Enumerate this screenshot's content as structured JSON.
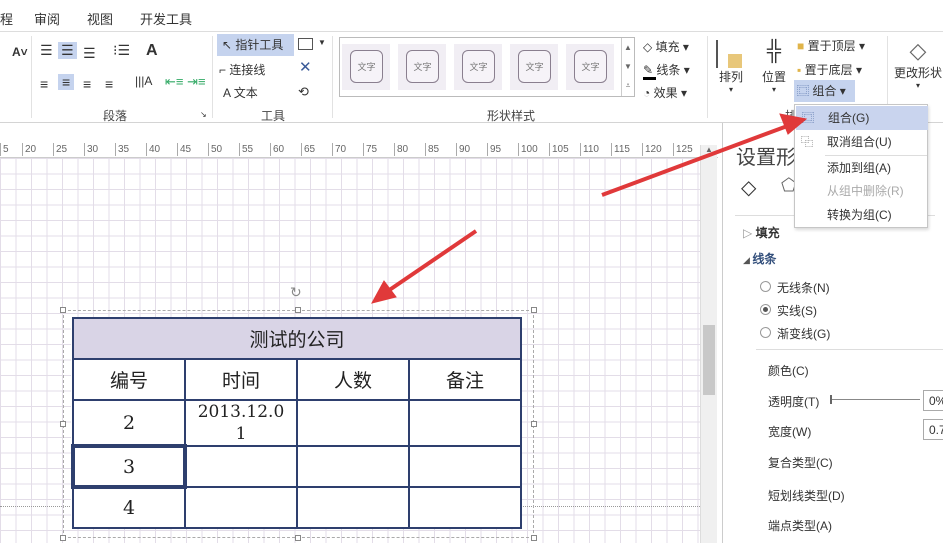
{
  "menu": {
    "tabs": [
      "程",
      "审阅",
      "视图",
      "开发工具"
    ]
  },
  "ribbon": {
    "paragraph_group": "段落",
    "tools_group": {
      "label": "工具",
      "pointer": "指针工具",
      "connector": "连接线",
      "text": "文本"
    },
    "shape_styles_group": {
      "label": "形状样式",
      "tile_text": "文字",
      "fill": "填充",
      "line": "线条",
      "effect": "效果"
    },
    "arrange_group": {
      "label": "排",
      "arrange": "排列",
      "position": "位置",
      "bring_front": "置于顶层",
      "send_back": "置于底层",
      "group": "组合"
    },
    "change_shape": "更改形状"
  },
  "ruler": [
    "5",
    "20",
    "25",
    "30",
    "35",
    "40",
    "45",
    "50",
    "55",
    "60",
    "65",
    "70",
    "75",
    "80",
    "85",
    "90",
    "95",
    "100",
    "105",
    "110",
    "115",
    "120",
    "125"
  ],
  "group_menu": {
    "items": [
      {
        "label": "组合(G)",
        "enabled": true,
        "highlighted": true
      },
      {
        "label": "取消组合(U)",
        "enabled": true
      },
      {
        "label": "添加到组(A)",
        "enabled": true
      },
      {
        "label": "从组中删除(R)",
        "enabled": false
      },
      {
        "label": "转换为组(C)",
        "enabled": true
      }
    ]
  },
  "format_panel": {
    "title": "设置形",
    "fill_section": "填充",
    "line_section": "线条",
    "line_options": [
      {
        "label": "无线条(N)",
        "selected": false
      },
      {
        "label": "实线(S)",
        "selected": true
      },
      {
        "label": "渐变线(G)",
        "selected": false
      }
    ],
    "color": "颜色(C)",
    "transparency": {
      "label": "透明度(T)",
      "value": "0%"
    },
    "width": {
      "label": "宽度(W)",
      "value": "0.7"
    },
    "compound": "复合类型(C)",
    "dash": "短划线类型(D)",
    "cap": "端点类型(A)"
  },
  "table": {
    "title": "测试的公司",
    "headers": [
      "编号",
      "时间",
      "人数",
      "备注"
    ],
    "rows": [
      [
        "2",
        "2013.12.01",
        "",
        ""
      ],
      [
        "3",
        "",
        "",
        ""
      ],
      [
        "4",
        "",
        "",
        ""
      ]
    ]
  },
  "colors": {
    "accent": "#c5d3ee",
    "table_border": "#2e3f6e",
    "header_fill": "#d9d4e6",
    "arrow": "#e0393a"
  }
}
